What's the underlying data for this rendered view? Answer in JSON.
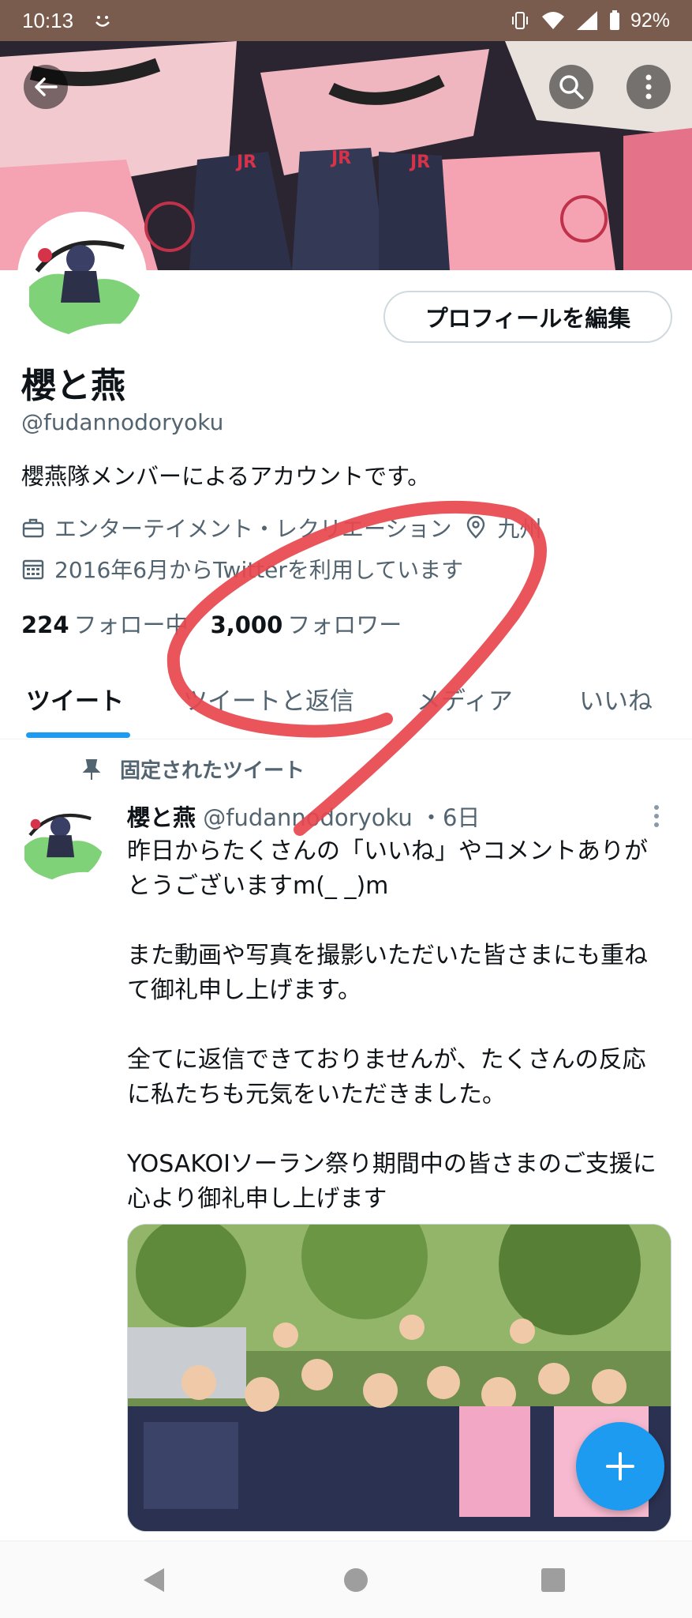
{
  "status_bar": {
    "time": "10:13",
    "battery": "92%",
    "icons": [
      "smile-icon",
      "vibrate-icon",
      "wifi-icon",
      "signal-icon",
      "battery-icon"
    ]
  },
  "header": {
    "back_icon": "arrow-left-icon",
    "search_icon": "search-icon",
    "more_icon": "more-vertical-icon"
  },
  "profile": {
    "edit_button": "プロフィールを編集",
    "name": "櫻と燕",
    "handle": "@fudannodoryoku",
    "bio": "櫻燕隊メンバーによるアカウントです。",
    "category": "エンターテイメント・レクリエーション",
    "location": "九州",
    "joined": "2016年6月からTwitterを利用しています",
    "following_count": "224",
    "following_label": "フォロー中",
    "followers_count": "3,000",
    "followers_label": "フォロワー"
  },
  "tabs": [
    {
      "label": "ツイート",
      "active": true
    },
    {
      "label": "ツイートと返信",
      "active": false
    },
    {
      "label": "メディア",
      "active": false
    },
    {
      "label": "いいね",
      "active": false
    }
  ],
  "tweet": {
    "pinned_label": "固定されたツイート",
    "author_name": "櫻と燕",
    "author_handle": "@fudannodoryoku",
    "time": "・6日",
    "paragraphs": [
      "昨日からたくさんの「いいね」やコメントありがとうございますm(_ _)m",
      "また動画や写真を撮影いただいた皆さまにも重ねて御礼申し上げます。",
      "全てに返信できておりませんが、たくさんの反応に私たちも元気をいただきました。",
      "YOSAKOIソーラン祭り期間中の皆さまのご支援に心より御礼申し上げます"
    ]
  },
  "colors": {
    "accent": "#1d9bf0",
    "text": "#0f1419",
    "secondary_text": "#536471",
    "status_bar": "#7a5c4e",
    "scribble": "#e8464e"
  }
}
